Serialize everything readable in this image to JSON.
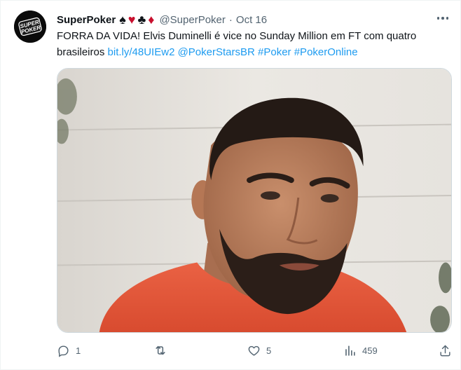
{
  "tweet": {
    "author_name": "SuperPoker",
    "author_suits": [
      "♠",
      "♥",
      "♣",
      "♦"
    ],
    "handle": "@SuperPoker",
    "separator": "·",
    "date": "Oct 16",
    "avatar_logo_line1": "SUPER",
    "avatar_logo_line2": "POKER",
    "text_plain": "FORRA DA VIDA! Elvis Duminelli é vice no Sunday Million em FT com quatro brasileiros ",
    "link_url": "bit.ly/48UIEw2",
    "mention": "@PokerStarsBR",
    "hashtags": [
      "#Poker",
      "#PokerOnline"
    ]
  },
  "actions": {
    "reply_count": "1",
    "retweet_count": "",
    "like_count": "5",
    "view_count": "459"
  },
  "colors": {
    "link": "#1d9bf0",
    "text": "#0f1419",
    "secondary": "#536471",
    "shirt": "#e4573a",
    "suit_red": "#c8102e"
  }
}
